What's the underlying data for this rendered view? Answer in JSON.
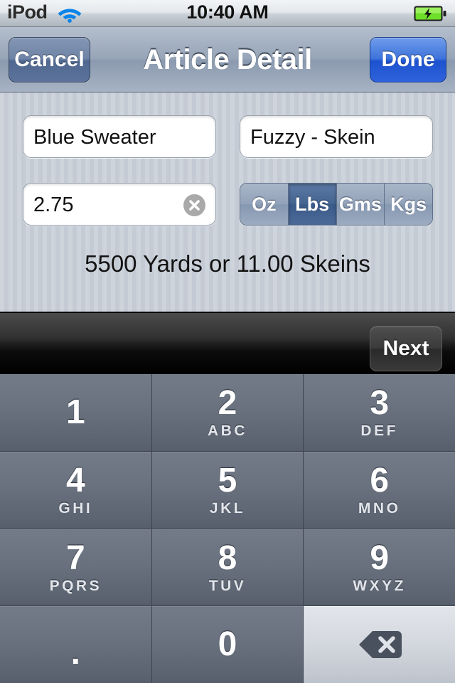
{
  "status_bar": {
    "carrier": "iPod",
    "wifi_icon": "wifi-icon",
    "time": "10:40 AM",
    "battery_icon": "battery-charging-icon"
  },
  "nav_bar": {
    "cancel_label": "Cancel",
    "title": "Article Detail",
    "done_label": "Done"
  },
  "form": {
    "name_value": "Blue Sweater",
    "description_value": "Fuzzy - Skein",
    "quantity_value": "2.75",
    "clear_icon": "clear-circle-icon",
    "units": [
      {
        "label": "Oz",
        "selected": false
      },
      {
        "label": "Lbs",
        "selected": true
      },
      {
        "label": "Gms",
        "selected": false
      },
      {
        "label": "Kgs",
        "selected": false
      }
    ],
    "result_text": "5500 Yards or 11.00 Skeins"
  },
  "keyboard_toolbar": {
    "next_label": "Next"
  },
  "keypad": {
    "rows": [
      [
        {
          "digit": "1",
          "letters": ""
        },
        {
          "digit": "2",
          "letters": "ABC"
        },
        {
          "digit": "3",
          "letters": "DEF"
        }
      ],
      [
        {
          "digit": "4",
          "letters": "GHI"
        },
        {
          "digit": "5",
          "letters": "JKL"
        },
        {
          "digit": "6",
          "letters": "MNO"
        }
      ],
      [
        {
          "digit": "7",
          "letters": "PQRS"
        },
        {
          "digit": "8",
          "letters": "TUV"
        },
        {
          "digit": "9",
          "letters": "WXYZ"
        }
      ],
      [
        {
          "digit": ".",
          "letters": ""
        },
        {
          "digit": "0",
          "letters": ""
        },
        {
          "digit": "",
          "letters": "",
          "icon": "backspace-icon"
        }
      ]
    ]
  },
  "colors": {
    "accent_blue": "#2f63dc",
    "segment_selected": "#3a5a89",
    "key_face": "#6a7280",
    "key_light": "#d5d9df",
    "pinstripe_light": "#ced4dc",
    "pinstripe_dark": "#c4cbd5",
    "battery_green": "#5fd321"
  }
}
